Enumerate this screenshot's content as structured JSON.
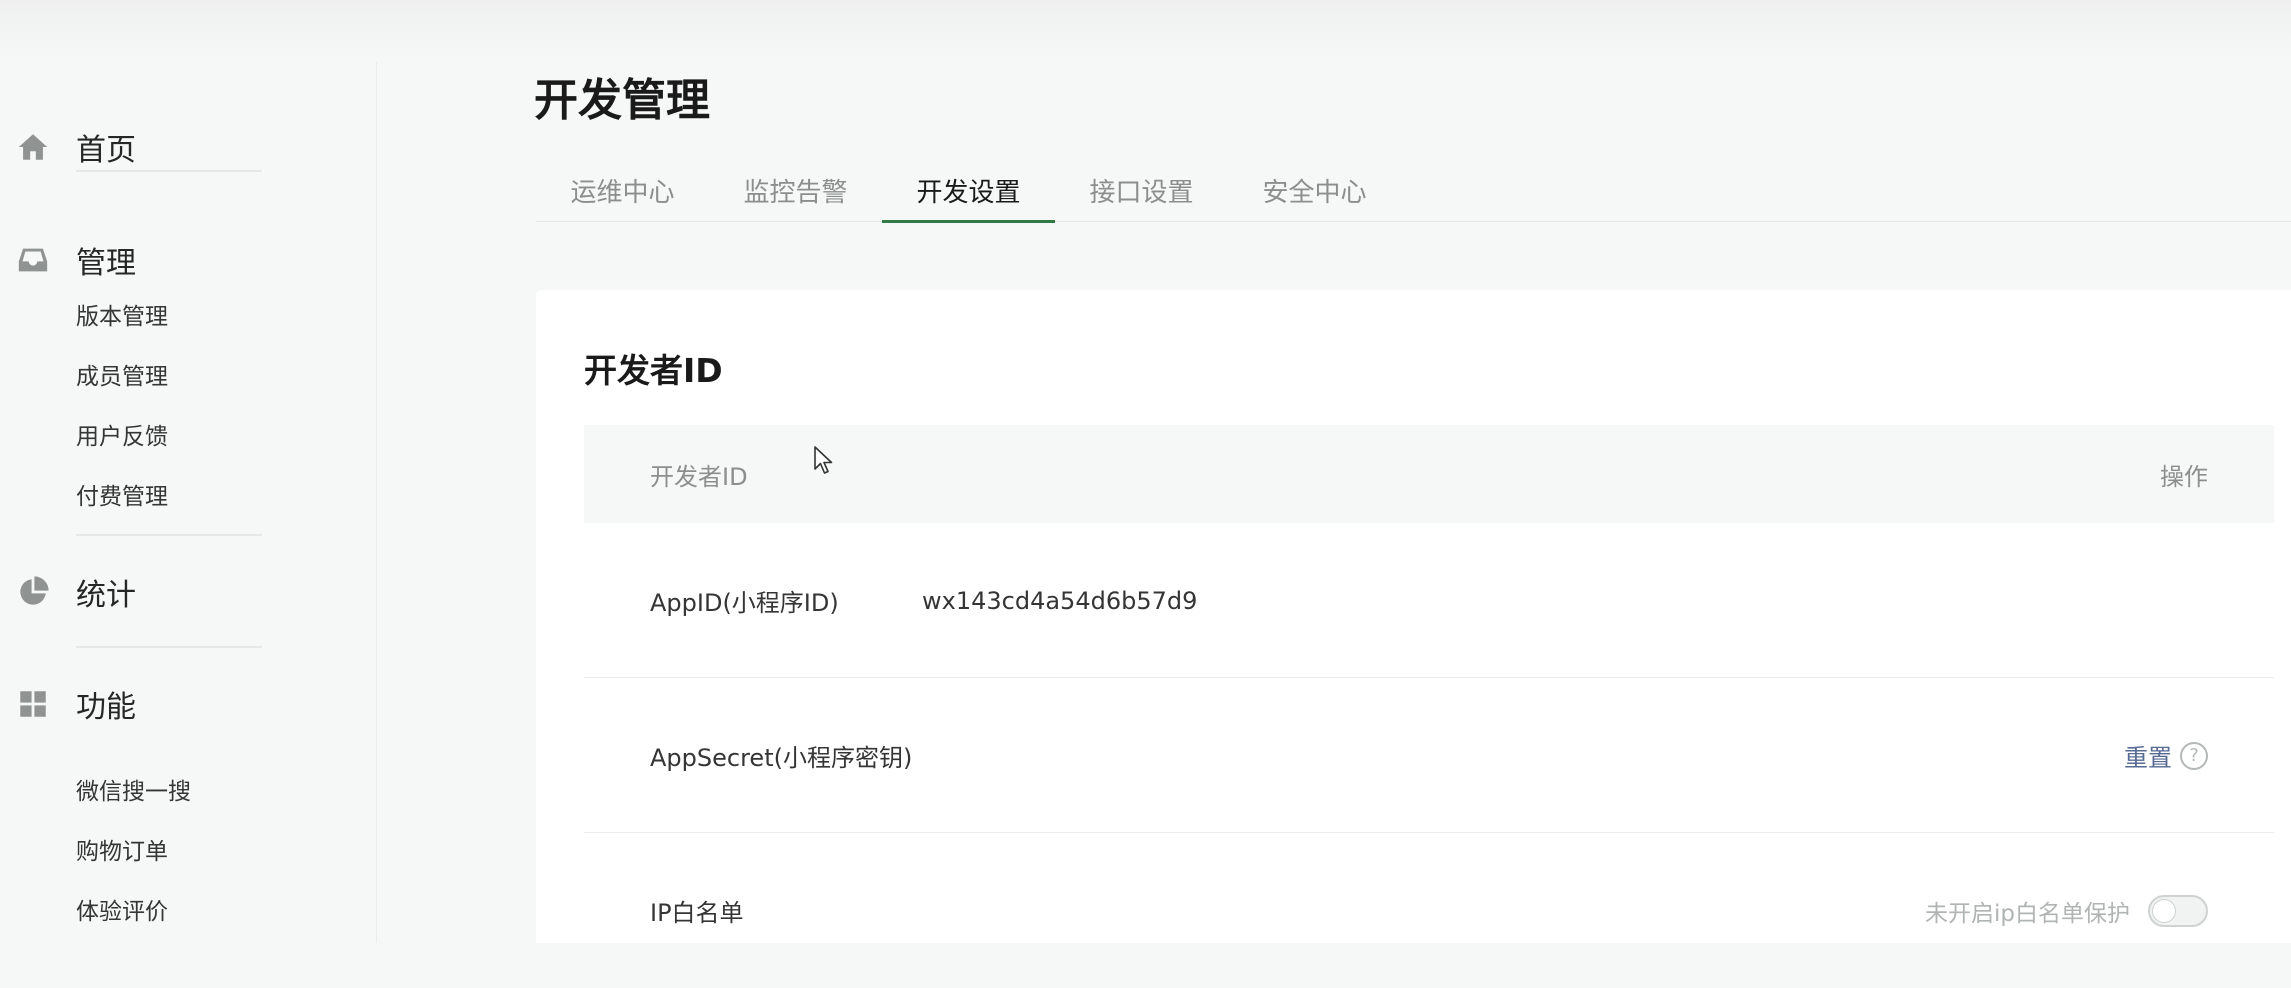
{
  "sidebar": {
    "sections": [
      {
        "label": "首页",
        "icon": "home-icon"
      },
      {
        "label": "管理",
        "icon": "inbox-icon"
      },
      {
        "label": "统计",
        "icon": "pie-chart-icon"
      },
      {
        "label": "功能",
        "icon": "grid-icon"
      }
    ],
    "manage_items": [
      "版本管理",
      "成员管理",
      "用户反馈",
      "付费管理"
    ],
    "feature_items": [
      "微信搜一搜",
      "购物订单",
      "体验评价"
    ]
  },
  "page": {
    "title": "开发管理",
    "tabs": [
      "运维中心",
      "监控告警",
      "开发设置",
      "接口设置",
      "安全中心"
    ],
    "active_tab": "开发设置"
  },
  "card": {
    "title": "开发者ID",
    "table": {
      "headers": {
        "id": "开发者ID",
        "action": "操作"
      },
      "rows": [
        {
          "label": "AppID(小程序ID)",
          "value": "wx143cd4a54d6b57d9"
        },
        {
          "label": "AppSecret(小程序密钥)",
          "action": "重置",
          "help": "?"
        },
        {
          "label": "IP白名单",
          "status_text": "未开启ip白名单保护",
          "toggle_on": false
        }
      ]
    }
  },
  "colors": {
    "accent": "#2f7a45",
    "link": "#576b95",
    "background": "#f6f8f8"
  }
}
